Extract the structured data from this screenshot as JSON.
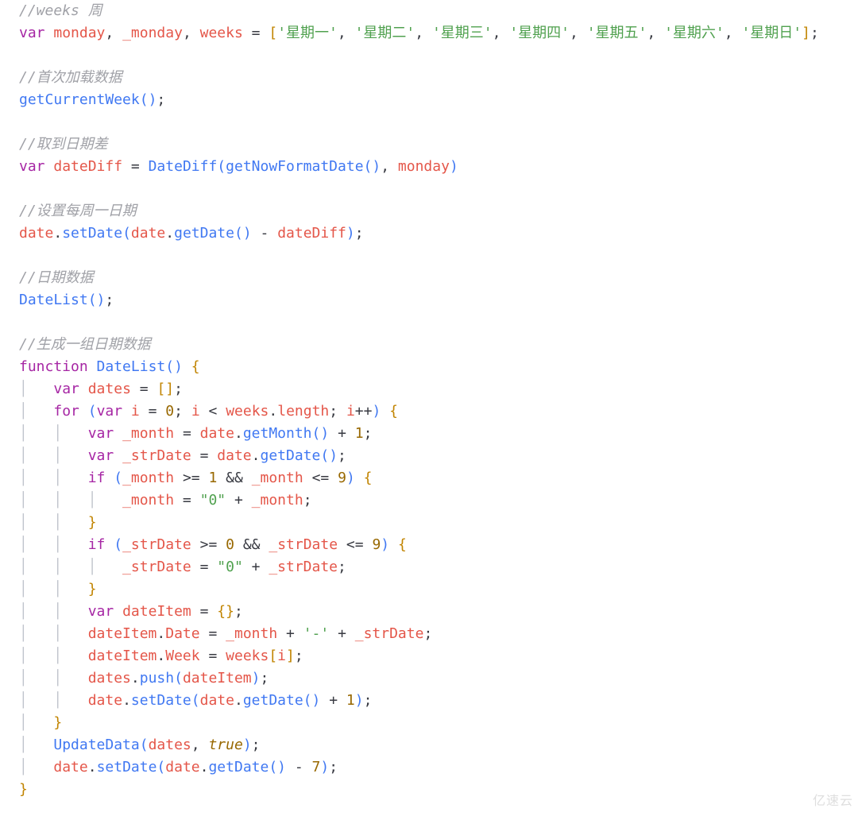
{
  "code": {
    "comment_weeks": "//weeks 周",
    "kw_var": "var",
    "v_monday": "monday",
    "v_umonday": "_monday",
    "v_weeks": "weeks",
    "op_eq": "=",
    "weeks_arr_open": "[",
    "weeks_items": [
      "'星期一'",
      "'星期二'",
      "'星期三'",
      "'星期四'",
      "'星期五'",
      "'星期六'",
      "'星期日'"
    ],
    "weeks_arr_close": "]",
    "comma": ",",
    "semi": ";",
    "comment_first_load": "//首次加载数据",
    "fn_getCurrentWeek": "getCurrentWeek",
    "paren_open": "(",
    "paren_close": ")",
    "comment_date_diff": "//取到日期差",
    "v_dateDiff": "dateDiff",
    "fn_DateDiff": "DateDiff",
    "fn_getNowFormatDate": "getNowFormatDate",
    "comment_set_monday": "//设置每周一日期",
    "v_date": "date",
    "dot": ".",
    "fn_setDate": "setDate",
    "fn_getDate": "getDate",
    "op_minus": "-",
    "comment_date_data": "//日期数据",
    "fn_DateList": "DateList",
    "comment_gen_dates": "//生成一组日期数据",
    "kw_function": "function",
    "brace_open": "{",
    "brace_close": "}",
    "v_dates": "dates",
    "arr_empty": "[]",
    "kw_for": "for",
    "v_i": "i",
    "num_0": "0",
    "op_lt": "<",
    "prop_length": "length",
    "op_pp": "++",
    "v_umonth": "_month",
    "fn_getMonth": "getMonth",
    "op_plus": "+",
    "num_1": "1",
    "v_ustrDate": "_strDate",
    "kw_if": "if",
    "op_ge": ">=",
    "op_and": "&&",
    "op_le": "<=",
    "num_9": "9",
    "str_zero": "\"0\"",
    "v_dateItem": "dateItem",
    "obj_empty": "{}",
    "prop_Date": "Date",
    "str_dash": "'-'",
    "prop_Week": "Week",
    "fn_push": "push",
    "fn_UpdateData": "UpdateData",
    "bool_true": "true",
    "num_7": "7"
  },
  "watermark": "亿速云",
  "chart_data": {
    "type": "table",
    "title": "JavaScript code snippet",
    "lines": [
      "//weeks 周",
      "var monday, _monday, weeks = ['星期一', '星期二', '星期三', '星期四', '星期五', '星期六', '星期日'];",
      "",
      "//首次加载数据",
      "getCurrentWeek();",
      "",
      "//取到日期差",
      "var dateDiff = DateDiff(getNowFormatDate(), monday)",
      "",
      "//设置每周一日期",
      "date.setDate(date.getDate() - dateDiff);",
      "",
      "//日期数据",
      "DateList();",
      "",
      "//生成一组日期数据",
      "function DateList() {",
      "    var dates = [];",
      "    for (var i = 0; i < weeks.length; i++) {",
      "        var _month = date.getMonth() + 1;",
      "        var _strDate = date.getDate();",
      "        if (_month >= 1 && _month <= 9) {",
      "            _month = \"0\" + _month;",
      "        }",
      "        if (_strDate >= 0 && _strDate <= 9) {",
      "            _strDate = \"0\" + _strDate;",
      "        }",
      "        var dateItem = {};",
      "        dateItem.Date = _month + '-' + _strDate;",
      "        dateItem.Week = weeks[i];",
      "        dates.push(dateItem);",
      "        date.setDate(date.getDate() + 1);",
      "    }",
      "    UpdateData(dates, true);",
      "    date.setDate(date.getDate() - 7);",
      "}"
    ]
  }
}
